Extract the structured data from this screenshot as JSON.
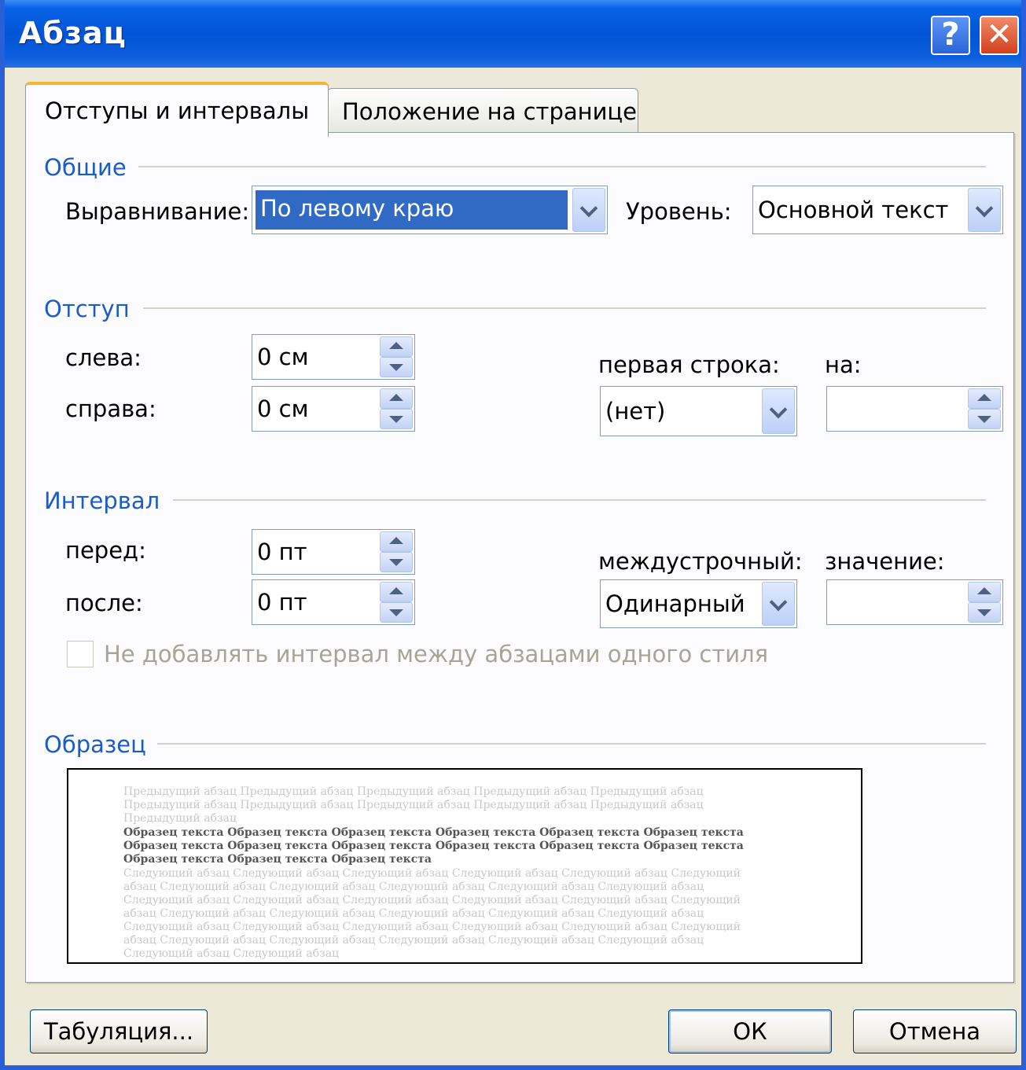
{
  "window": {
    "title": "Абзац",
    "help_glyph": "?",
    "close_glyph": "✕"
  },
  "tabs": [
    {
      "label": "Отступы и интервалы",
      "selected": true
    },
    {
      "label": "Положение на странице",
      "selected": false
    }
  ],
  "general": {
    "section_title": "Общие",
    "alignment_label": "Выравнивание:",
    "alignment_value": "По левому краю",
    "level_label": "Уровень:",
    "level_value": "Основной текст"
  },
  "indent": {
    "section_title": "Отступ",
    "left_label": "слева:",
    "left_value": "0 см",
    "right_label": "справа:",
    "right_value": "0 см",
    "first_line_label": "первая строка:",
    "first_line_value": "(нет)",
    "by_label": "на:",
    "by_value": ""
  },
  "spacing": {
    "section_title": "Интервал",
    "before_label": "перед:",
    "before_value": "0 пт",
    "after_label": "после:",
    "after_value": "0 пт",
    "line_spacing_label": "междустрочный:",
    "line_spacing_value": "Одинарный",
    "at_label": "значение:",
    "at_value": "",
    "no_space_same_style_label": "Не добавлять интервал между абзацами одного стиля",
    "no_space_same_style_checked": false
  },
  "preview": {
    "section_title": "Образец",
    "previous_text": "Предыдущий абзац Предыдущий абзац Предыдущий абзац Предыдущий абзац Предыдущий абзац Предыдущий абзац Предыдущий абзац Предыдущий абзац Предыдущий абзац Предыдущий абзац Предыдущий абзац",
    "sample_text": "Образец текста Образец текста Образец текста Образец текста Образец текста Образец текста Образец текста Образец текста Образец текста Образец текста Образец текста Образец текста Образец текста Образец текста Образец текста",
    "next_text": "Следующий абзац Следующий абзац Следующий абзац Следующий абзац Следующий абзац Следующий абзац Следующий абзац Следующий абзац Следующий абзац Следующий абзац Следующий абзац Следующий абзац Следующий абзац Следующий абзац Следующий абзац Следующий абзац Следующий абзац Следующий абзац Следующий абзац Следующий абзац Следующий абзац Следующий абзац Следующий абзац Следующий абзац Следующий абзац Следующий абзац Следующий абзац Следующий абзац Следующий абзац Следующий абзац Следующий абзац Следующий абзац Следующий абзац Следующий абзац Следующий абзац"
  },
  "buttons": {
    "tabs": "Табуляция...",
    "ok": "ОК",
    "cancel": "Отмена"
  },
  "colors": {
    "title_bar": "#0254d6",
    "section_title": "#1a5cc8",
    "selection": "#316ac5"
  }
}
